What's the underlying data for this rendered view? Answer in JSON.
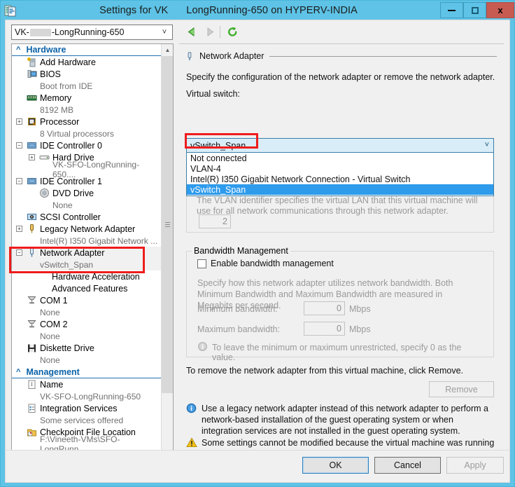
{
  "window": {
    "title_left": "Settings for VK",
    "title_right": "LongRunning-650 on HYPERV-INDIA",
    "icon": "settings-document-icon",
    "minimize_label": "",
    "maximize_label": "",
    "close_label": "x",
    "titlebar_color": "#5ec3e6",
    "close_button_color": "#c75b52"
  },
  "toolbar": {
    "vm_selector_prefix": "VK-",
    "vm_selector_suffix": "-LongRunning-650",
    "vm_selector_redacted": true,
    "back_icon": "back-arrow-icon",
    "forward_icon": "forward-arrow-icon",
    "refresh_icon": "refresh-icon",
    "back_enabled": true,
    "forward_enabled": false
  },
  "tree": {
    "hardware_group": "Hardware",
    "management_group": "Management",
    "hardware_items": [
      {
        "label": "Add Hardware",
        "icon": "add-hardware-icon",
        "sub": null,
        "expander": null,
        "level": 1
      },
      {
        "label": "BIOS",
        "icon": "bios-icon",
        "sub": "Boot from IDE",
        "expander": null,
        "level": 1
      },
      {
        "label": "Memory",
        "icon": "memory-icon",
        "sub": "8192 MB",
        "expander": null,
        "level": 1
      },
      {
        "label": "Processor",
        "icon": "processor-icon",
        "sub": "8 Virtual processors",
        "expander": "plus",
        "level": 1
      },
      {
        "label": "IDE Controller 0",
        "icon": "ide-controller-icon",
        "sub": null,
        "expander": "minus",
        "level": 1
      },
      {
        "label": "Hard Drive",
        "icon": "hard-drive-icon",
        "sub": "VK-SFO-LongRunning-650....",
        "expander": "plus",
        "level": 2
      },
      {
        "label": "IDE Controller 1",
        "icon": "ide-controller-icon",
        "sub": null,
        "expander": "minus",
        "level": 1
      },
      {
        "label": "DVD Drive",
        "icon": "dvd-drive-icon",
        "sub": "None",
        "expander": null,
        "level": 2
      },
      {
        "label": "SCSI Controller",
        "icon": "scsi-controller-icon",
        "sub": null,
        "expander": null,
        "level": 1
      },
      {
        "label": "Legacy Network Adapter",
        "icon": "network-adapter-icon",
        "sub": "Intel(R) I350 Gigabit Network ...",
        "expander": "plus",
        "level": 1
      },
      {
        "label": "Network Adapter",
        "icon": "network-adapter-icon",
        "sub": "vSwitch_Span",
        "expander": "minus",
        "level": 1,
        "selected": true,
        "annotated": true
      },
      {
        "label": "Hardware Acceleration",
        "icon": null,
        "sub": null,
        "expander": null,
        "level": 2
      },
      {
        "label": "Advanced Features",
        "icon": null,
        "sub": null,
        "expander": null,
        "level": 2
      },
      {
        "label": "COM 1",
        "icon": "com-port-icon",
        "sub": "None",
        "expander": null,
        "level": 1
      },
      {
        "label": "COM 2",
        "icon": "com-port-icon",
        "sub": "None",
        "expander": null,
        "level": 1
      },
      {
        "label": "Diskette Drive",
        "icon": "diskette-drive-icon",
        "sub": "None",
        "expander": null,
        "level": 1
      }
    ],
    "management_items": [
      {
        "label": "Name",
        "icon": "name-icon",
        "sub": "VK-SFO-LongRunning-650",
        "level": 1
      },
      {
        "label": "Integration Services",
        "icon": "integration-services-icon",
        "sub": "Some services offered",
        "level": 1
      },
      {
        "label": "Checkpoint File Location",
        "icon": "checkpoint-folder-icon",
        "sub": "F:\\Vineeth-VMs\\SFO-LongRunn...",
        "level": 1
      }
    ]
  },
  "panel": {
    "section_title": "Network Adapter",
    "section_icon": "network-adapter-icon",
    "description": "Specify the configuration of the network adapter or remove the network adapter.",
    "virtual_switch_label": "Virtual switch:",
    "virtual_switch_value": "vSwitch_Span",
    "virtual_switch_options": [
      "Not connected",
      "VLAN-4",
      "Intel(R) I350 Gigabit Network Connection - Virtual Switch",
      "vSwitch_Span"
    ],
    "virtual_switch_selected_index": 3,
    "dropdown_open": true,
    "vlan": {
      "description": "The VLAN identifier specifies the virtual LAN that this virtual machine will use for all network communications through this network adapter.",
      "value": "2",
      "enabled": false
    },
    "bandwidth": {
      "group_title": "Bandwidth Management",
      "enable_label": "Enable bandwidth management",
      "enable_checked": false,
      "description": "Specify how this network adapter utilizes network bandwidth. Both Minimum Bandwidth and Maximum Bandwidth are measured in Megabits per second.",
      "min_label": "Minimum bandwidth:",
      "min_value": "0",
      "min_unit": "Mbps",
      "max_label": "Maximum bandwidth:",
      "max_value": "0",
      "max_unit": "Mbps",
      "note_icon": "info-icon",
      "note": "To leave the minimum or maximum unrestricted, specify 0 as the value."
    },
    "remove_text": "To remove the network adapter from this virtual machine, click Remove.",
    "remove_button": "Remove",
    "remove_enabled": false,
    "info_icon": "info-icon",
    "info_text": "Use a legacy network adapter instead of this network adapter to perform a network-based installation of the guest operating system or when integration services are not installed in the guest operating system.",
    "warning_icon": "warning-icon",
    "warning_text": "Some settings cannot be modified because the virtual machine was running when this window was opened. To modify a setting that is unavailable, shut down the virtual machine and then reopen this window."
  },
  "footer": {
    "ok": "OK",
    "cancel": "Cancel",
    "apply": "Apply",
    "apply_enabled": false
  },
  "annotations": {
    "highlight_color": "#ee1c1c",
    "boxes": [
      {
        "target": "tree-network-adapter"
      },
      {
        "target": "dropdown-vswitch-span-option"
      }
    ]
  }
}
